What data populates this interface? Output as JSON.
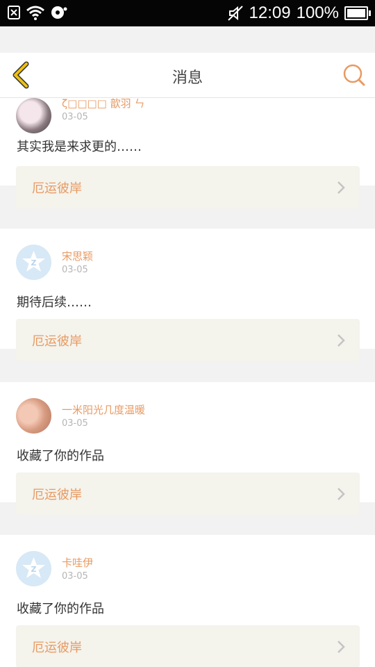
{
  "status_bar": {
    "time": "12:09",
    "battery_text": "100%",
    "battery_level": 1.0,
    "icons": [
      "sim-error-icon",
      "wifi-icon",
      "sync-icon",
      "mute-icon",
      "battery-icon"
    ]
  },
  "header": {
    "title": "消息",
    "back_icon": "chevron-left-icon",
    "search_icon": "search-icon"
  },
  "colors": {
    "accent": "#e89a62",
    "back_icon": "#f0c010",
    "card_bg": "#f4f3ec",
    "default_avatar": "#d7e8f6"
  },
  "messages": [
    {
      "user": "ζ□□□□ 歆羽 ㄣ",
      "date": "03-05",
      "text": "其实我是来求更的……",
      "work": "厄运彼岸",
      "avatar": "photo"
    },
    {
      "user": "宋思颖",
      "date": "03-05",
      "text": "期待后续……",
      "work": "厄运彼岸",
      "avatar": "default"
    },
    {
      "user": "一米阳光几度温暖",
      "date": "03-05",
      "text": "收藏了你的作品",
      "work": "厄运彼岸",
      "avatar": "photo"
    },
    {
      "user": "卡哇伊",
      "date": "03-05",
      "text": "收藏了你的作品",
      "work": "厄运彼岸",
      "avatar": "default"
    }
  ]
}
